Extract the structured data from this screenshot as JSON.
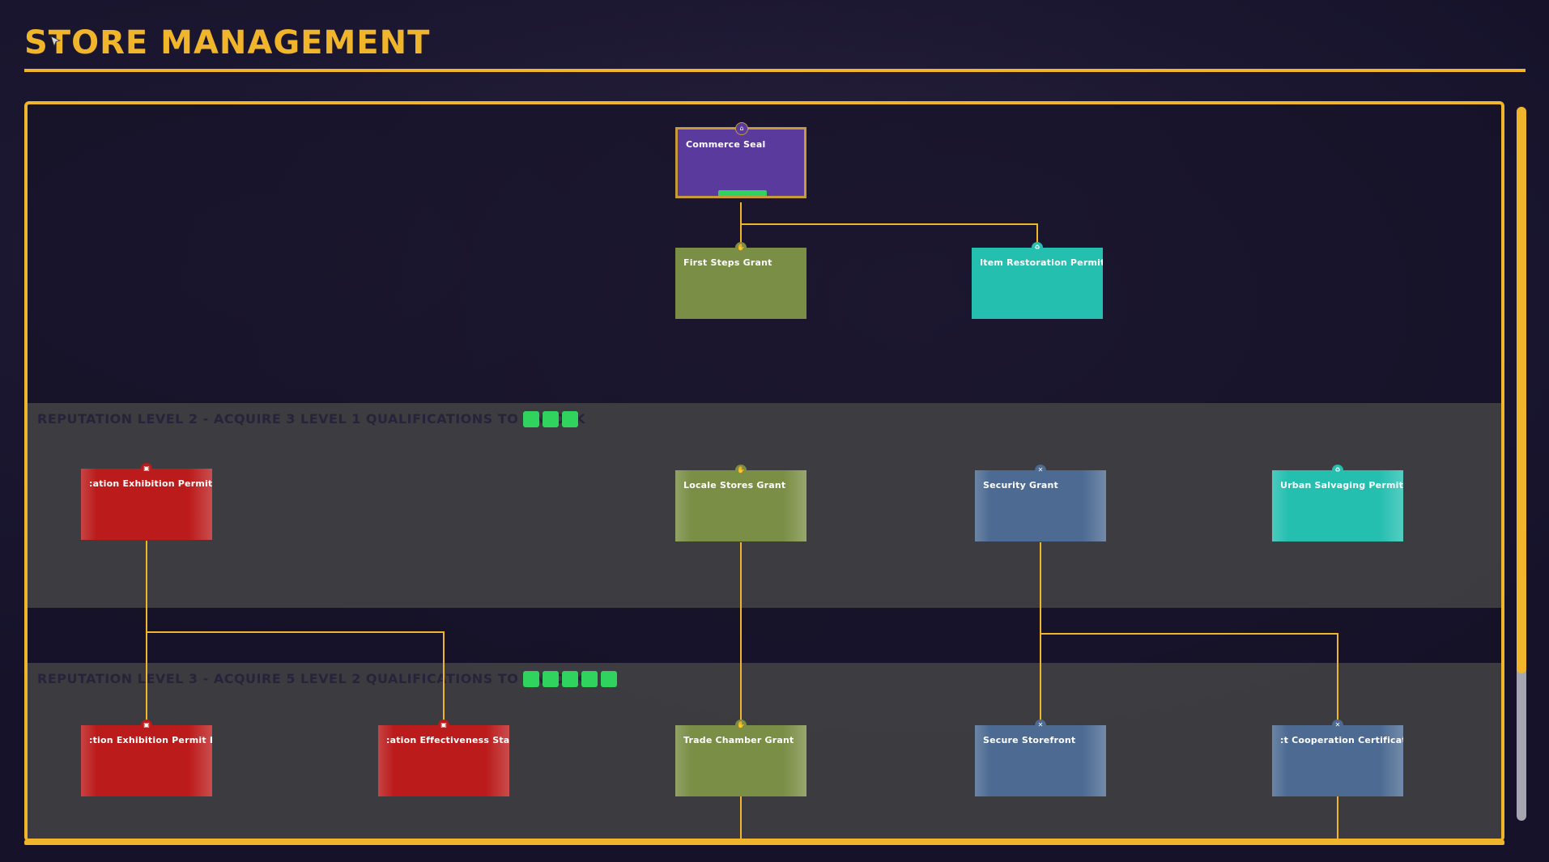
{
  "page": {
    "title": "STORE MANAGEMENT"
  },
  "colors": {
    "accent": "#f1b52b",
    "unlocked": "#2fd35e",
    "purple": "#5b3a9e",
    "olive": "#7a8e45",
    "teal": "#25bfb0",
    "steel": "#4c6a92",
    "red": "#bb1b1b"
  },
  "levels": [
    {
      "label": "REPUTATION LEVEL 2 - ACQUIRE 3 LEVEL 1 QUALIFICATIONS TO UNLOCK",
      "pips": 3
    },
    {
      "label": "REPUTATION LEVEL 3 - ACQUIRE 5 LEVEL 2 QUALIFICATIONS TO UNLOCK",
      "pips": 5
    }
  ],
  "nodes": {
    "commerce_seal": {
      "name": "Commerce Seal",
      "icon": "bank-icon"
    },
    "first_steps": {
      "name": "First Steps Grant",
      "icon": "handshake-icon"
    },
    "item_restoration": {
      "name": "Item Restoration Permit",
      "icon": "recycle-icon"
    },
    "exhibition_permit": {
      "name": ":ation Exhibition Permit",
      "icon": "gift-icon"
    },
    "locale_stores": {
      "name": "Locale Stores Grant",
      "icon": "handshake-icon"
    },
    "security_grant": {
      "name": "Security Grant",
      "icon": "tools-icon"
    },
    "urban_salvaging": {
      "name": "Urban Salvaging Permit",
      "icon": "recycle-icon"
    },
    "exhibition_permit_2": {
      "name": ":tion Exhibition Permit II",
      "icon": "gift-icon"
    },
    "effectiveness_stamp": {
      "name": ":ation Effectiveness Stam",
      "icon": "gift-icon"
    },
    "trade_chamber": {
      "name": "Trade Chamber Grant",
      "icon": "handshake-icon"
    },
    "secure_storefront": {
      "name": "Secure Storefront",
      "icon": "tools-icon"
    },
    "cooperation_cert": {
      "name": ":t Cooperation Certificate",
      "icon": "tools-icon"
    }
  }
}
